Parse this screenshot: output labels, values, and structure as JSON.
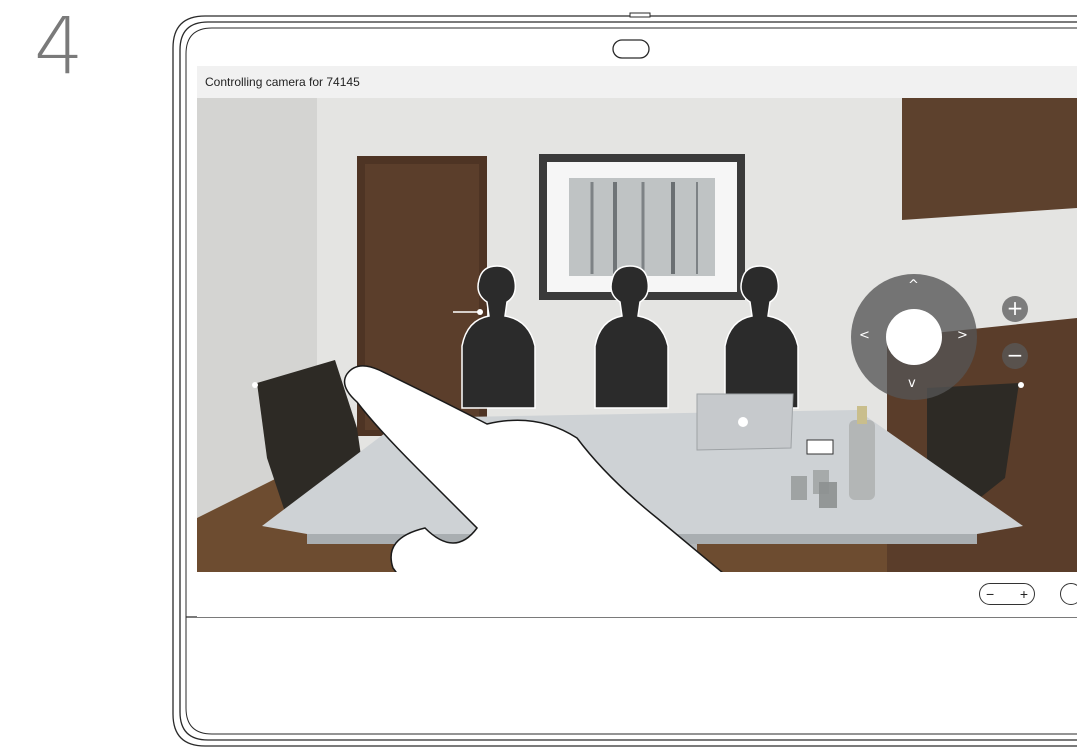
{
  "step": {
    "number": "4"
  },
  "call": {
    "status_text": "Controlling camera for 74145"
  },
  "camera_control": {
    "up_symbol": "^",
    "down_symbol": "v",
    "left_symbol": "<",
    "right_symbol": ">",
    "zoom_in_symbol": "+",
    "zoom_out_symbol": "−"
  },
  "bottom_bar": {
    "volume_minus": "−",
    "volume_plus": "+"
  },
  "icons": {
    "gesture": "hand-pointer-icon",
    "apple_logo": "apple-logo-icon"
  },
  "colors": {
    "ptz_ring": "#5a5a5a",
    "wall": "#e6e6e4",
    "floor": "#6b4a2e",
    "table": "#cfd3d6"
  }
}
